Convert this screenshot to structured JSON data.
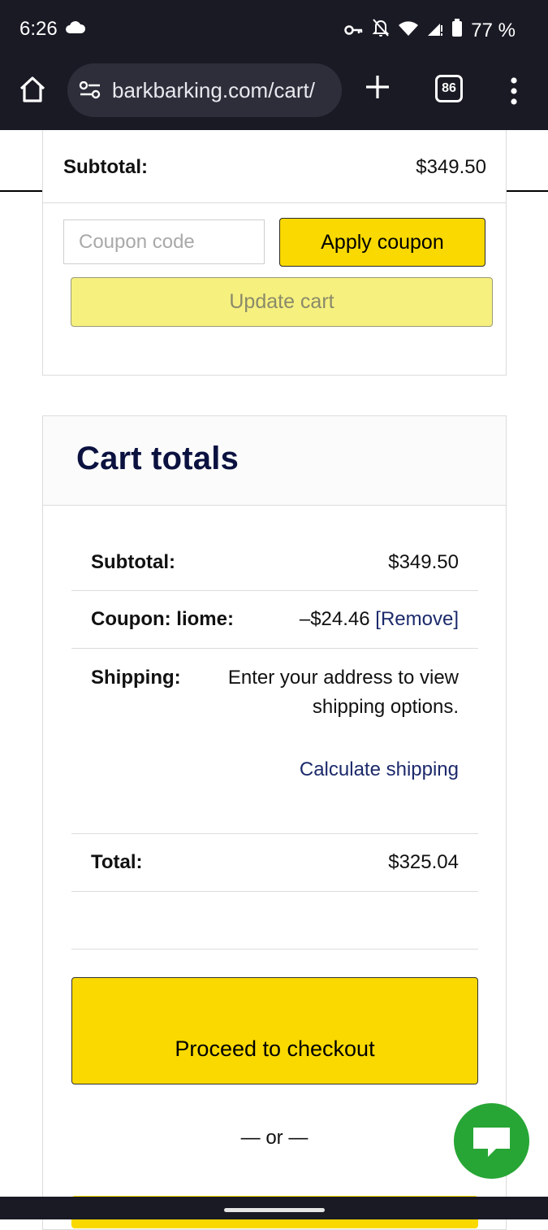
{
  "status_bar": {
    "time": "6:26",
    "battery": "77 %",
    "icons": [
      "cloud-icon",
      "key-icon",
      "bell-off-icon",
      "wifi-icon",
      "signal-icon",
      "battery-icon"
    ]
  },
  "browser": {
    "url": "barkbarking.com/cart/",
    "tab_count": "86",
    "icons": [
      "home-icon",
      "site-settings-icon",
      "plus-icon",
      "tabs-icon",
      "menu-icon"
    ]
  },
  "coupon_section": {
    "subtotal_label": "Subtotal:",
    "subtotal_value": "$349.50",
    "coupon_placeholder": "Coupon code",
    "apply_label": "Apply coupon",
    "update_label": "Update cart"
  },
  "cart_totals": {
    "title": "Cart totals",
    "subtotal_label": "Subtotal:",
    "subtotal_value": "$349.50",
    "coupon_label": "Coupon: liome:",
    "coupon_value": "–$24.46",
    "coupon_remove": "[Remove]",
    "shipping_label": "Shipping:",
    "shipping_text": "Enter your address to view shipping options.",
    "calculate_shipping": "Calculate shipping",
    "total_label": "Total:",
    "total_value": "$325.04",
    "checkout_label": "Proceed to checkout",
    "or_text": "— or —"
  },
  "colors": {
    "brand_yellow": "#f9d900",
    "navy": "#0b1240",
    "chat_green": "#27a635",
    "chrome_dark": "#191a24"
  }
}
